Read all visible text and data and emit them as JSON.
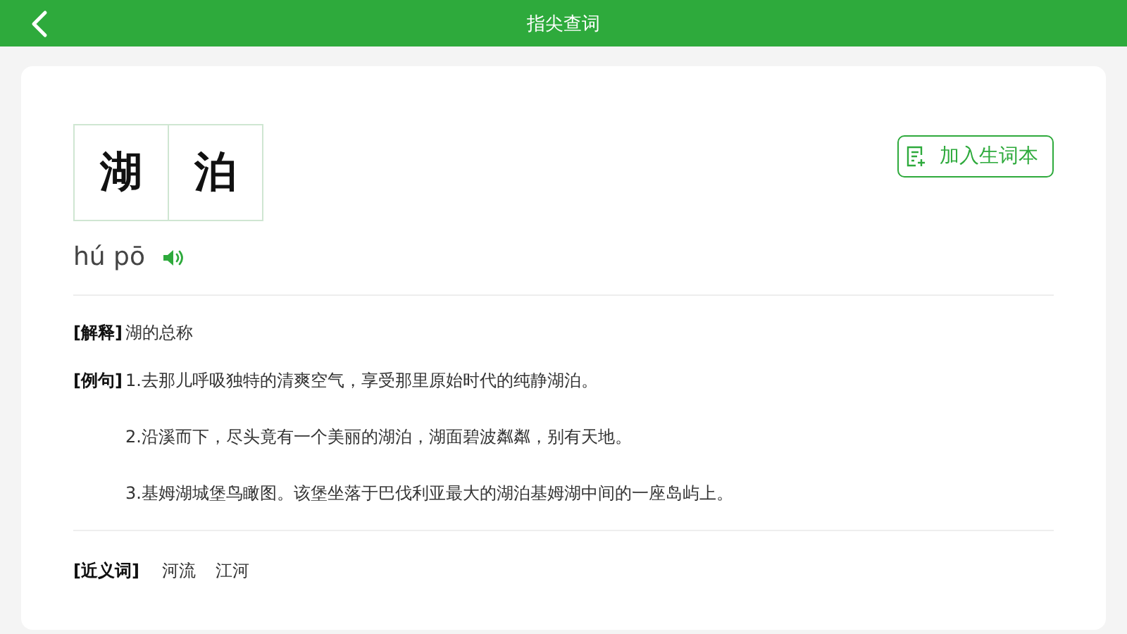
{
  "header": {
    "title": "指尖查词"
  },
  "word": {
    "characters": [
      "湖",
      "泊"
    ],
    "pinyin": "hú pō"
  },
  "add_button": {
    "label": "加入生词本"
  },
  "sections": [
    {
      "label": "[解释]",
      "lines": [
        "湖的总称"
      ]
    },
    {
      "label": "[例句]",
      "lines": [
        "1.去那儿呼吸独特的清爽空气，享受那里原始时代的纯静湖泊。",
        "2.沿溪而下，尽头竟有一个美丽的湖泊，湖面碧波粼粼，别有天地。",
        "3.基姆湖城堡鸟瞰图。该堡坐落于巴伐利亚最大的湖泊基姆湖中间的一座岛屿上。"
      ]
    }
  ],
  "synonyms": {
    "label": "[近义词]",
    "words": [
      "河流",
      "江河"
    ]
  }
}
